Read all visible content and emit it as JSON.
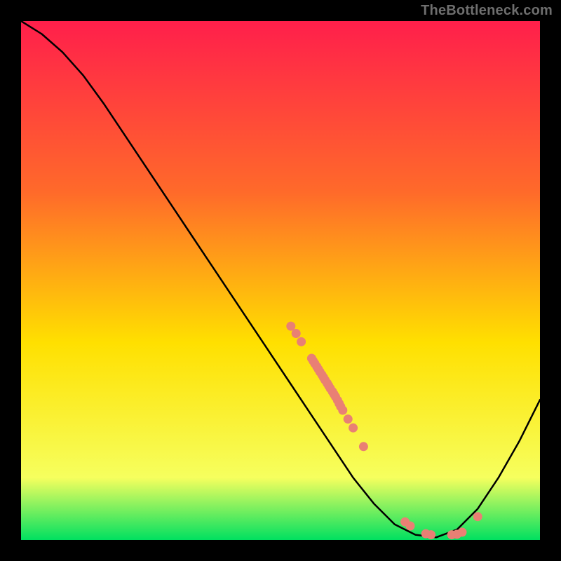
{
  "watermark": "TheBottleneck.com",
  "colors": {
    "gradient_top": "#ff1f4b",
    "gradient_mid1": "#ff6a2a",
    "gradient_mid2": "#ffe000",
    "gradient_mid3": "#f6ff5e",
    "gradient_bottom": "#00e060",
    "curve": "#000000",
    "marker": "#e98074",
    "frame": "#000000"
  },
  "chart_data": {
    "type": "line",
    "title": "",
    "xlabel": "",
    "ylabel": "",
    "xlim": [
      0,
      100
    ],
    "ylim": [
      0,
      100
    ],
    "curve": {
      "x": [
        0,
        4,
        8,
        12,
        16,
        20,
        24,
        28,
        32,
        36,
        40,
        44,
        48,
        52,
        56,
        60,
        64,
        68,
        72,
        76,
        80,
        84,
        88,
        92,
        96,
        100
      ],
      "y": [
        100,
        97.5,
        94,
        89.5,
        84,
        78,
        72,
        66,
        60,
        54,
        48,
        42,
        36,
        30,
        24,
        18,
        12,
        7,
        3,
        1,
        0.5,
        2,
        6,
        12,
        19,
        27
      ]
    },
    "markers": [
      {
        "x": 52,
        "y": 41.2
      },
      {
        "x": 53,
        "y": 39.8
      },
      {
        "x": 54,
        "y": 38.2
      },
      {
        "x": 56,
        "y": 35.0
      },
      {
        "x": 56.3,
        "y": 34.5
      },
      {
        "x": 56.6,
        "y": 34.0
      },
      {
        "x": 57,
        "y": 33.4
      },
      {
        "x": 57.3,
        "y": 32.9
      },
      {
        "x": 57.6,
        "y": 32.4
      },
      {
        "x": 58,
        "y": 31.8
      },
      {
        "x": 58.3,
        "y": 31.3
      },
      {
        "x": 58.6,
        "y": 30.8
      },
      {
        "x": 59,
        "y": 30.2
      },
      {
        "x": 59.3,
        "y": 29.7
      },
      {
        "x": 59.6,
        "y": 29.2
      },
      {
        "x": 60,
        "y": 28.6
      },
      {
        "x": 60.3,
        "y": 28.1
      },
      {
        "x": 60.6,
        "y": 27.6
      },
      {
        "x": 61,
        "y": 26.9
      },
      {
        "x": 61.3,
        "y": 26.3
      },
      {
        "x": 61.6,
        "y": 25.7
      },
      {
        "x": 62,
        "y": 25.0
      },
      {
        "x": 63,
        "y": 23.3
      },
      {
        "x": 64,
        "y": 21.6
      },
      {
        "x": 66,
        "y": 18.0
      },
      {
        "x": 74,
        "y": 3.5
      },
      {
        "x": 75,
        "y": 2.7
      },
      {
        "x": 78,
        "y": 1.2
      },
      {
        "x": 79,
        "y": 1.0
      },
      {
        "x": 83,
        "y": 1.0
      },
      {
        "x": 84,
        "y": 1.1
      },
      {
        "x": 85,
        "y": 1.5
      },
      {
        "x": 88,
        "y": 4.5
      }
    ]
  }
}
